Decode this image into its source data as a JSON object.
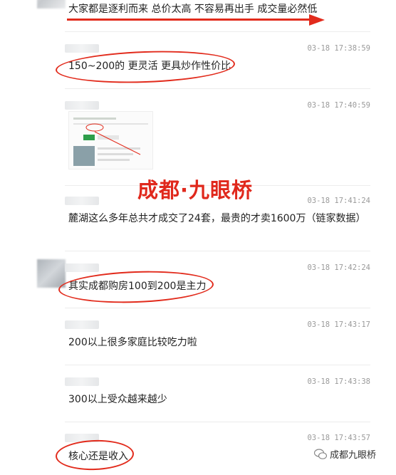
{
  "messages": [
    {
      "time": "",
      "text": "大家都是逐利而来 总价太高 不容易再出手 成交量必然低"
    },
    {
      "time": "03-18 17:38:59",
      "text": "150~200的 更灵活 更具炒作性价比"
    },
    {
      "time": "03-18 17:40:59",
      "text": ""
    },
    {
      "time": "03-18 17:41:24",
      "text": "麓湖这么多年总共才成交了24套，最贵的才卖1600万（链家数据）"
    },
    {
      "time": "03-18 17:42:24",
      "text": "其实成都购房100到200是主力"
    },
    {
      "time": "03-18 17:43:17",
      "text": "200以上很多家庭比较吃力啦"
    },
    {
      "time": "03-18 17:43:38",
      "text": "300以上受众越来越少"
    },
    {
      "time": "03-18 17:43:57",
      "text": "核心还是收入"
    }
  ],
  "overlay": {
    "watermark": "成都·九眼桥"
  },
  "brand": {
    "name": "成都九眼桥",
    "icon": "wechat-icon"
  },
  "colors": {
    "annotation": "#e22b1c",
    "text": "#222222",
    "time": "#9a9a9a"
  }
}
